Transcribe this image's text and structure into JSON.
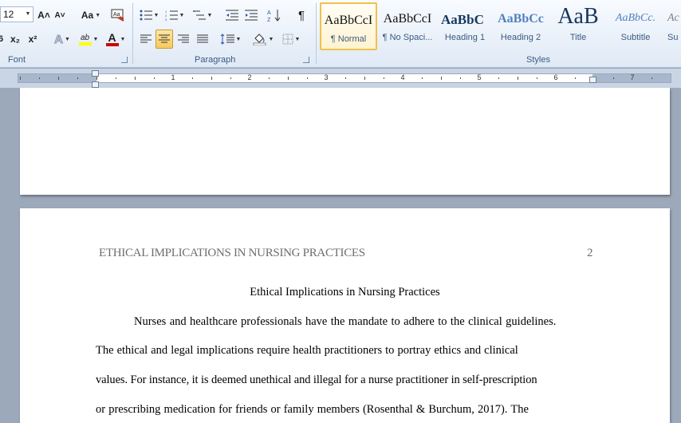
{
  "ribbon": {
    "font_group": {
      "label": "Font",
      "font_size": "12",
      "grow_font": "A˄",
      "shrink_font": "A˅",
      "change_case": "Aa",
      "clear_format": "Aa",
      "subscript": "x₂",
      "superscript": "x²",
      "text_effects": "A",
      "highlight": "ab",
      "font_color": "A",
      "font_color_value": "#d00000",
      "highlight_color_value": "#ffff00"
    },
    "paragraph_group": {
      "label": "Paragraph",
      "sort": "↓",
      "show_marks": "¶"
    },
    "styles_group": {
      "label": "Styles",
      "styles": [
        {
          "preview": "AaBbCcI",
          "name": "¶ Normal",
          "selected": true
        },
        {
          "preview": "AaBbCcI",
          "name": "¶ No Spaci..."
        },
        {
          "preview": "AaBbC",
          "name": "Heading 1"
        },
        {
          "preview": "AaBbCc",
          "name": "Heading 2"
        },
        {
          "preview": "AaB",
          "name": "Title"
        },
        {
          "preview": "AaBbCc.",
          "name": "Subtitle"
        },
        {
          "preview": "Ac",
          "name": "Su"
        }
      ]
    }
  },
  "ruler": {
    "numbers": [
      "1",
      "2",
      "3",
      "4",
      "5",
      "6",
      "7"
    ]
  },
  "document": {
    "header_text": "ETHICAL IMPLICATIONS IN NURSING PRACTICES",
    "page_number": "2",
    "title": "Ethical Implications in Nursing Practices",
    "lines": [
      "Nurses and healthcare professionals have the mandate to adhere to the clinical guidelines.",
      "The ethical and legal implications require health practitioners to portray ethics and clinical",
      "values. For instance, it is deemed unethical and illegal for a nurse practitioner in self-prescription",
      "or prescribing medication for friends or family members (Rosenthal & Burchum, 2017). The"
    ]
  }
}
